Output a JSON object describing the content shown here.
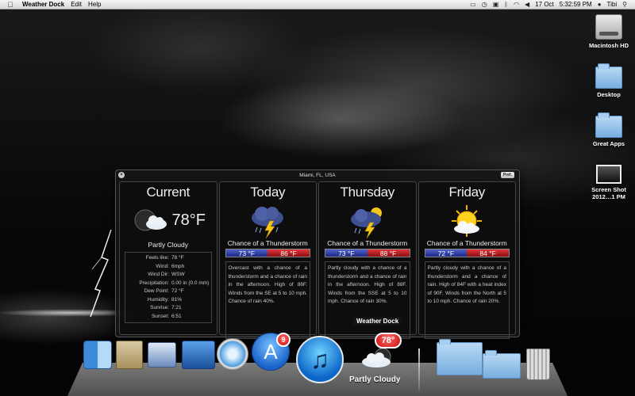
{
  "menubar": {
    "app_name": "Weather Dock",
    "menus": [
      "Edit",
      "Help"
    ],
    "date": "17 Oct",
    "time": "5:32:59 PM",
    "user": "Tibi"
  },
  "desktop_icons": [
    {
      "label": "Macintosh HD",
      "icon": "hard-drive-icon"
    },
    {
      "label": "Desktop",
      "icon": "folder-icon"
    },
    {
      "label": "Great Apps",
      "icon": "folder-icon"
    },
    {
      "label": "Screen Shot\n2012…1 PM",
      "icon": "screenshot-icon"
    }
  ],
  "panel": {
    "location": "Miami, FL, USA",
    "pref_label": "Pref.",
    "current": {
      "title": "Current",
      "temp": "78°F",
      "condition": "Partly Cloudy",
      "details": [
        {
          "k": "Feels like:",
          "v": "78 °F"
        },
        {
          "k": "Wind:",
          "v": "6mph"
        },
        {
          "k": "Wind Dir:",
          "v": "WSW"
        },
        {
          "k": "Precipitation:",
          "v": "0.00 in (0.0 mm)"
        },
        {
          "k": "Dew Point:",
          "v": "72 °F"
        },
        {
          "k": "Humidity:",
          "v": "81%"
        },
        {
          "k": "Sunrise:",
          "v": "7:21"
        },
        {
          "k": "Sunset:",
          "v": "6:51"
        }
      ]
    },
    "forecast": [
      {
        "day": "Today",
        "condition": "Chance of a Thunderstorm",
        "low": "73 °F",
        "high": "86 °F",
        "description": "Overcast with a chance of a thunderstorm and a chance of rain in the afternoon. High of 86F. Winds from the SE at 5 to 10 mph. Chance of rain 40%."
      },
      {
        "day": "Thursday",
        "condition": "Chance of a Thunderstorm",
        "low": "73 °F",
        "high": "88 °F",
        "description": "Partly cloudy with a chance of a thunderstorm and a chance of rain in the afternoon. High of 88F. Winds from the SSE at 5 to 10 mph. Chance of rain 30%."
      },
      {
        "day": "Friday",
        "condition": "Chance of a Thunderstorm",
        "low": "72 °F",
        "high": "84 °F",
        "description": "Partly cloudy with a chance of a thunderstorm and a chance of rain. High of 84F with a heat index of 90F. Winds from the North at 5 to 10 mph. Chance of rain 20%."
      }
    ]
  },
  "tooltip": "Weather Dock",
  "dock": {
    "appstore_badge": "9",
    "weather_temp": "78°",
    "weather_label": "Partly Cloudy"
  }
}
